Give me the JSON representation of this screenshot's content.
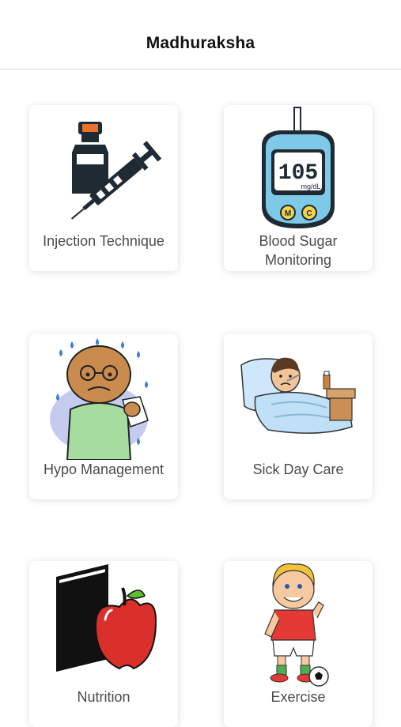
{
  "nav": {
    "title": "Madhuraksha"
  },
  "cards": [
    {
      "label": "Injection Technique"
    },
    {
      "label": "Blood Sugar Monitoring",
      "meter_reading": "105",
      "meter_unit": "mg/dL",
      "button_left": "M",
      "button_right": "C"
    },
    {
      "label": "Hypo Management"
    },
    {
      "label": "Sick Day Care"
    },
    {
      "label": "Nutrition"
    },
    {
      "label": "Exercise"
    }
  ],
  "colors": {
    "card_bg": "#ffffff",
    "label_text": "#4a4a4a",
    "meter_blue": "#7ec8e8",
    "apple_red": "#d9302c",
    "vial_orange": "#e8732c"
  }
}
